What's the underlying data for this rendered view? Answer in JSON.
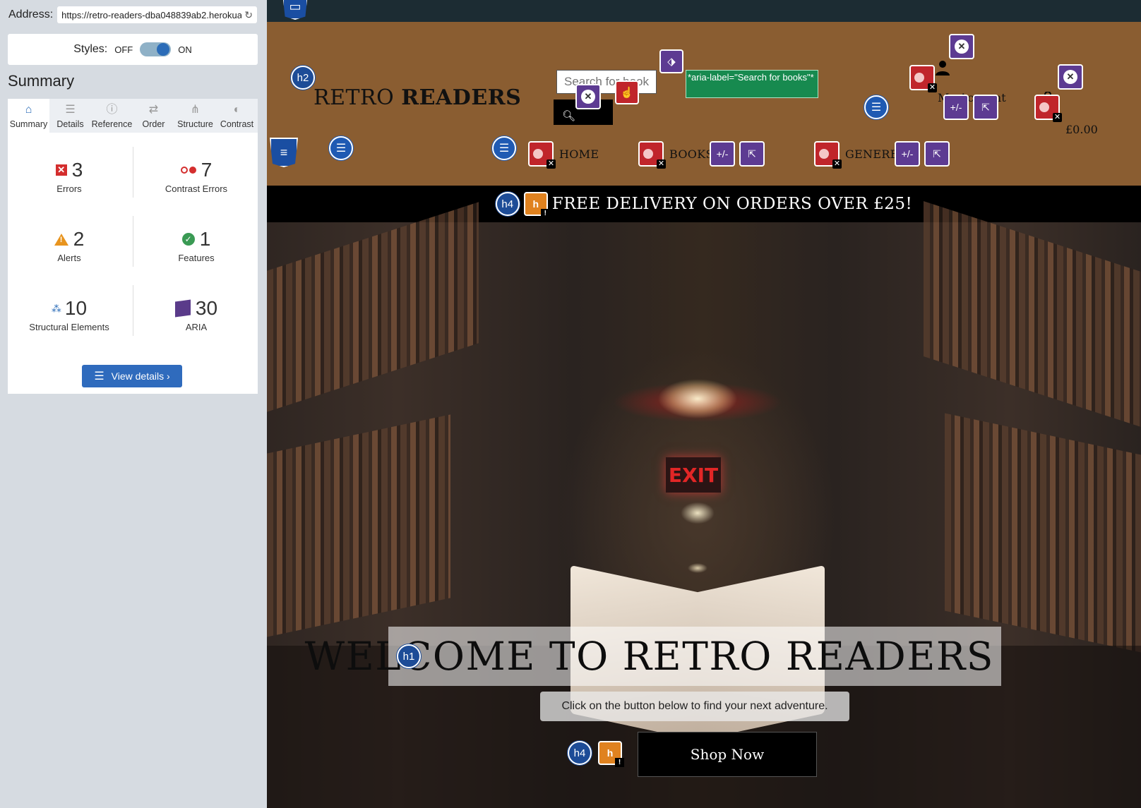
{
  "panel": {
    "address_label": "Address:",
    "address_value": "https://retro-readers-dba048839ab2.herokuapp.com/",
    "styles_label": "Styles:",
    "toggle_off": "OFF",
    "toggle_on": "ON",
    "summary_title": "Summary",
    "tabs": [
      {
        "label": "Summary",
        "icon": "home-icon"
      },
      {
        "label": "Details",
        "icon": "list-icon"
      },
      {
        "label": "Reference",
        "icon": "info-icon"
      },
      {
        "label": "Order",
        "icon": "order-icon"
      },
      {
        "label": "Structure",
        "icon": "structure-icon"
      },
      {
        "label": "Contrast",
        "icon": "contrast-icon"
      }
    ],
    "stats": {
      "errors": {
        "value": "3",
        "label": "Errors"
      },
      "contrast": {
        "value": "7",
        "label": "Contrast Errors"
      },
      "alerts": {
        "value": "2",
        "label": "Alerts"
      },
      "features": {
        "value": "1",
        "label": "Features"
      },
      "structural": {
        "value": "10",
        "label": "Structural Elements"
      },
      "aria": {
        "value": "30",
        "label": "ARIA"
      }
    },
    "view_details": "View details ›"
  },
  "site": {
    "logo_regular": "RETRO",
    "logo_bold": "READERS",
    "search_placeholder": "Search for books",
    "aria_tooltip": "*aria-label=\"Search for books\"*",
    "account": "My Account",
    "cart_total": "£0.00",
    "nav": {
      "home": "HOME",
      "books": "BOOKS",
      "genere": "GENERE"
    },
    "promo": "FREE DELIVERY ON ORDERS OVER £25!",
    "exit_sign": "EXIT",
    "hero_title": "WELCOME TO RETRO READERS",
    "hero_sub": "Click on the button below to find your next adventure.",
    "shop_button": "Shop Now"
  },
  "annotations": {
    "h1": "h1",
    "h2": "h2",
    "h4": "h4",
    "aria_expanded": "+/-",
    "alert_glyph": "h",
    "error_x": "✕",
    "alert_bang": "!"
  },
  "colors": {
    "header_bg": "#8a5d31",
    "topbar_bg": "#1c2c33",
    "promo_bg": "#000000",
    "error_red": "#c0252b",
    "aria_purple": "#5d3b92",
    "heading_blue": "#1d4c97",
    "alert_orange": "#e0821f",
    "tooltip_green": "#178a4f"
  }
}
